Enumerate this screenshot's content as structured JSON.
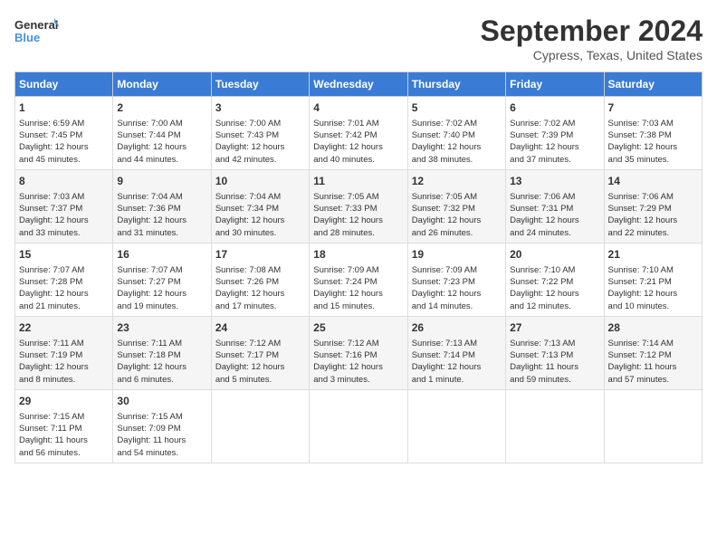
{
  "logo": {
    "line1": "General",
    "line2": "Blue"
  },
  "title": "September 2024",
  "location": "Cypress, Texas, United States",
  "days_of_week": [
    "Sunday",
    "Monday",
    "Tuesday",
    "Wednesday",
    "Thursday",
    "Friday",
    "Saturday"
  ],
  "weeks": [
    [
      {
        "num": "1",
        "info": "Sunrise: 6:59 AM\nSunset: 7:45 PM\nDaylight: 12 hours\nand 45 minutes."
      },
      {
        "num": "2",
        "info": "Sunrise: 7:00 AM\nSunset: 7:44 PM\nDaylight: 12 hours\nand 44 minutes."
      },
      {
        "num": "3",
        "info": "Sunrise: 7:00 AM\nSunset: 7:43 PM\nDaylight: 12 hours\nand 42 minutes."
      },
      {
        "num": "4",
        "info": "Sunrise: 7:01 AM\nSunset: 7:42 PM\nDaylight: 12 hours\nand 40 minutes."
      },
      {
        "num": "5",
        "info": "Sunrise: 7:02 AM\nSunset: 7:40 PM\nDaylight: 12 hours\nand 38 minutes."
      },
      {
        "num": "6",
        "info": "Sunrise: 7:02 AM\nSunset: 7:39 PM\nDaylight: 12 hours\nand 37 minutes."
      },
      {
        "num": "7",
        "info": "Sunrise: 7:03 AM\nSunset: 7:38 PM\nDaylight: 12 hours\nand 35 minutes."
      }
    ],
    [
      {
        "num": "8",
        "info": "Sunrise: 7:03 AM\nSunset: 7:37 PM\nDaylight: 12 hours\nand 33 minutes."
      },
      {
        "num": "9",
        "info": "Sunrise: 7:04 AM\nSunset: 7:36 PM\nDaylight: 12 hours\nand 31 minutes."
      },
      {
        "num": "10",
        "info": "Sunrise: 7:04 AM\nSunset: 7:34 PM\nDaylight: 12 hours\nand 30 minutes."
      },
      {
        "num": "11",
        "info": "Sunrise: 7:05 AM\nSunset: 7:33 PM\nDaylight: 12 hours\nand 28 minutes."
      },
      {
        "num": "12",
        "info": "Sunrise: 7:05 AM\nSunset: 7:32 PM\nDaylight: 12 hours\nand 26 minutes."
      },
      {
        "num": "13",
        "info": "Sunrise: 7:06 AM\nSunset: 7:31 PM\nDaylight: 12 hours\nand 24 minutes."
      },
      {
        "num": "14",
        "info": "Sunrise: 7:06 AM\nSunset: 7:29 PM\nDaylight: 12 hours\nand 22 minutes."
      }
    ],
    [
      {
        "num": "15",
        "info": "Sunrise: 7:07 AM\nSunset: 7:28 PM\nDaylight: 12 hours\nand 21 minutes."
      },
      {
        "num": "16",
        "info": "Sunrise: 7:07 AM\nSunset: 7:27 PM\nDaylight: 12 hours\nand 19 minutes."
      },
      {
        "num": "17",
        "info": "Sunrise: 7:08 AM\nSunset: 7:26 PM\nDaylight: 12 hours\nand 17 minutes."
      },
      {
        "num": "18",
        "info": "Sunrise: 7:09 AM\nSunset: 7:24 PM\nDaylight: 12 hours\nand 15 minutes."
      },
      {
        "num": "19",
        "info": "Sunrise: 7:09 AM\nSunset: 7:23 PM\nDaylight: 12 hours\nand 14 minutes."
      },
      {
        "num": "20",
        "info": "Sunrise: 7:10 AM\nSunset: 7:22 PM\nDaylight: 12 hours\nand 12 minutes."
      },
      {
        "num": "21",
        "info": "Sunrise: 7:10 AM\nSunset: 7:21 PM\nDaylight: 12 hours\nand 10 minutes."
      }
    ],
    [
      {
        "num": "22",
        "info": "Sunrise: 7:11 AM\nSunset: 7:19 PM\nDaylight: 12 hours\nand 8 minutes."
      },
      {
        "num": "23",
        "info": "Sunrise: 7:11 AM\nSunset: 7:18 PM\nDaylight: 12 hours\nand 6 minutes."
      },
      {
        "num": "24",
        "info": "Sunrise: 7:12 AM\nSunset: 7:17 PM\nDaylight: 12 hours\nand 5 minutes."
      },
      {
        "num": "25",
        "info": "Sunrise: 7:12 AM\nSunset: 7:16 PM\nDaylight: 12 hours\nand 3 minutes."
      },
      {
        "num": "26",
        "info": "Sunrise: 7:13 AM\nSunset: 7:14 PM\nDaylight: 12 hours\nand 1 minute."
      },
      {
        "num": "27",
        "info": "Sunrise: 7:13 AM\nSunset: 7:13 PM\nDaylight: 11 hours\nand 59 minutes."
      },
      {
        "num": "28",
        "info": "Sunrise: 7:14 AM\nSunset: 7:12 PM\nDaylight: 11 hours\nand 57 minutes."
      }
    ],
    [
      {
        "num": "29",
        "info": "Sunrise: 7:15 AM\nSunset: 7:11 PM\nDaylight: 11 hours\nand 56 minutes."
      },
      {
        "num": "30",
        "info": "Sunrise: 7:15 AM\nSunset: 7:09 PM\nDaylight: 11 hours\nand 54 minutes."
      },
      {
        "num": "",
        "info": ""
      },
      {
        "num": "",
        "info": ""
      },
      {
        "num": "",
        "info": ""
      },
      {
        "num": "",
        "info": ""
      },
      {
        "num": "",
        "info": ""
      }
    ]
  ]
}
